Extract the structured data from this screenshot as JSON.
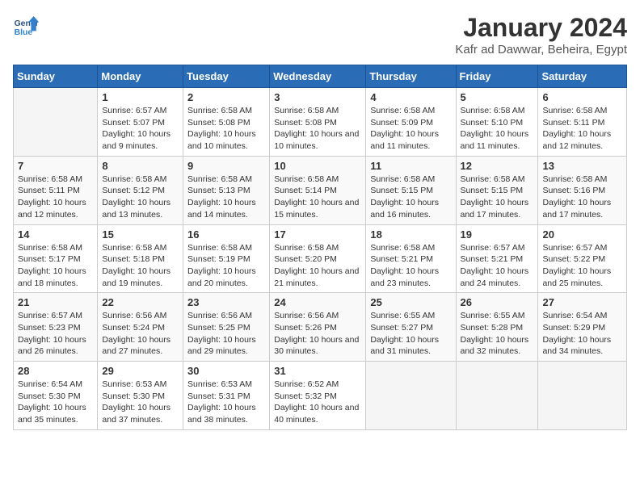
{
  "header": {
    "logo_line1": "General",
    "logo_line2": "Blue",
    "title": "January 2024",
    "subtitle": "Kafr ad Dawwar, Beheira, Egypt"
  },
  "weekdays": [
    "Sunday",
    "Monday",
    "Tuesday",
    "Wednesday",
    "Thursday",
    "Friday",
    "Saturday"
  ],
  "weeks": [
    [
      {
        "day": null
      },
      {
        "day": "1",
        "sunrise": "6:57 AM",
        "sunset": "5:07 PM",
        "daylight": "10 hours and 9 minutes."
      },
      {
        "day": "2",
        "sunrise": "6:58 AM",
        "sunset": "5:08 PM",
        "daylight": "10 hours and 10 minutes."
      },
      {
        "day": "3",
        "sunrise": "6:58 AM",
        "sunset": "5:08 PM",
        "daylight": "10 hours and 10 minutes."
      },
      {
        "day": "4",
        "sunrise": "6:58 AM",
        "sunset": "5:09 PM",
        "daylight": "10 hours and 11 minutes."
      },
      {
        "day": "5",
        "sunrise": "6:58 AM",
        "sunset": "5:10 PM",
        "daylight": "10 hours and 11 minutes."
      },
      {
        "day": "6",
        "sunrise": "6:58 AM",
        "sunset": "5:11 PM",
        "daylight": "10 hours and 12 minutes."
      }
    ],
    [
      {
        "day": "7",
        "sunrise": "6:58 AM",
        "sunset": "5:11 PM",
        "daylight": "10 hours and 12 minutes."
      },
      {
        "day": "8",
        "sunrise": "6:58 AM",
        "sunset": "5:12 PM",
        "daylight": "10 hours and 13 minutes."
      },
      {
        "day": "9",
        "sunrise": "6:58 AM",
        "sunset": "5:13 PM",
        "daylight": "10 hours and 14 minutes."
      },
      {
        "day": "10",
        "sunrise": "6:58 AM",
        "sunset": "5:14 PM",
        "daylight": "10 hours and 15 minutes."
      },
      {
        "day": "11",
        "sunrise": "6:58 AM",
        "sunset": "5:15 PM",
        "daylight": "10 hours and 16 minutes."
      },
      {
        "day": "12",
        "sunrise": "6:58 AM",
        "sunset": "5:15 PM",
        "daylight": "10 hours and 17 minutes."
      },
      {
        "day": "13",
        "sunrise": "6:58 AM",
        "sunset": "5:16 PM",
        "daylight": "10 hours and 17 minutes."
      }
    ],
    [
      {
        "day": "14",
        "sunrise": "6:58 AM",
        "sunset": "5:17 PM",
        "daylight": "10 hours and 18 minutes."
      },
      {
        "day": "15",
        "sunrise": "6:58 AM",
        "sunset": "5:18 PM",
        "daylight": "10 hours and 19 minutes."
      },
      {
        "day": "16",
        "sunrise": "6:58 AM",
        "sunset": "5:19 PM",
        "daylight": "10 hours and 20 minutes."
      },
      {
        "day": "17",
        "sunrise": "6:58 AM",
        "sunset": "5:20 PM",
        "daylight": "10 hours and 21 minutes."
      },
      {
        "day": "18",
        "sunrise": "6:58 AM",
        "sunset": "5:21 PM",
        "daylight": "10 hours and 23 minutes."
      },
      {
        "day": "19",
        "sunrise": "6:57 AM",
        "sunset": "5:21 PM",
        "daylight": "10 hours and 24 minutes."
      },
      {
        "day": "20",
        "sunrise": "6:57 AM",
        "sunset": "5:22 PM",
        "daylight": "10 hours and 25 minutes."
      }
    ],
    [
      {
        "day": "21",
        "sunrise": "6:57 AM",
        "sunset": "5:23 PM",
        "daylight": "10 hours and 26 minutes."
      },
      {
        "day": "22",
        "sunrise": "6:56 AM",
        "sunset": "5:24 PM",
        "daylight": "10 hours and 27 minutes."
      },
      {
        "day": "23",
        "sunrise": "6:56 AM",
        "sunset": "5:25 PM",
        "daylight": "10 hours and 29 minutes."
      },
      {
        "day": "24",
        "sunrise": "6:56 AM",
        "sunset": "5:26 PM",
        "daylight": "10 hours and 30 minutes."
      },
      {
        "day": "25",
        "sunrise": "6:55 AM",
        "sunset": "5:27 PM",
        "daylight": "10 hours and 31 minutes."
      },
      {
        "day": "26",
        "sunrise": "6:55 AM",
        "sunset": "5:28 PM",
        "daylight": "10 hours and 32 minutes."
      },
      {
        "day": "27",
        "sunrise": "6:54 AM",
        "sunset": "5:29 PM",
        "daylight": "10 hours and 34 minutes."
      }
    ],
    [
      {
        "day": "28",
        "sunrise": "6:54 AM",
        "sunset": "5:30 PM",
        "daylight": "10 hours and 35 minutes."
      },
      {
        "day": "29",
        "sunrise": "6:53 AM",
        "sunset": "5:30 PM",
        "daylight": "10 hours and 37 minutes."
      },
      {
        "day": "30",
        "sunrise": "6:53 AM",
        "sunset": "5:31 PM",
        "daylight": "10 hours and 38 minutes."
      },
      {
        "day": "31",
        "sunrise": "6:52 AM",
        "sunset": "5:32 PM",
        "daylight": "10 hours and 40 minutes."
      },
      {
        "day": null
      },
      {
        "day": null
      },
      {
        "day": null
      }
    ]
  ]
}
